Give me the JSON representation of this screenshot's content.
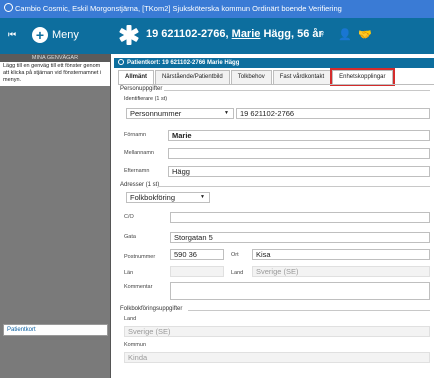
{
  "window": {
    "title": "Cambio Cosmic, Eskil Morgonstjärna, [TKom2] Sjuksköterska kommun Ordinärt boende Verifiering"
  },
  "header": {
    "menu_label": "Meny",
    "patient_pnr": "19 621102-2766,",
    "patient_firstname": "Marie",
    "patient_lastname": "Hägg,",
    "patient_age": "56 år",
    "icons": [
      "collapse-icon",
      "plus-circle-icon",
      "star-of-life-icon",
      "female-icon",
      "person-outline-icon",
      "handshake-icon"
    ]
  },
  "sidebar": {
    "title": "MINA GENVÄGAR",
    "hint": "Lägg till en genväg till ett fönster genom att klicka på stjärnan vid fönsternamnet i menyn.",
    "link": "Patientkort"
  },
  "patientcard": {
    "title": "Patientkort: 19 621102-2766 Marie Hägg",
    "tabs": [
      "Allmänt",
      "Närstående/Patientbild",
      "Tolkbehov",
      "Fast vårdkontakt",
      "Enhetskopplingar"
    ],
    "personuppgifter_label": "Personuppgifter",
    "identifierare_label": "Identifierare (1 st)",
    "id_type": "Personnummer",
    "id_value": "19 621102-2766",
    "fornamn_label": "Förnamn",
    "fornamn": "Marie",
    "mellannamn_label": "Mellannamn",
    "mellannamn": "",
    "efternamn_label": "Efternamn",
    "efternamn": "Hägg",
    "adresser_label": "Adresser (1 st)",
    "address_type": "Folkbokföring",
    "co_label": "C/O",
    "co": "",
    "gata_label": "Gata",
    "gata": "Storgatan 5",
    "postnummer_label": "Postnummer",
    "postnummer": "590 36",
    "ort_label": "Ort",
    "ort": "Kisa",
    "lan_label": "Län",
    "lan": "",
    "land_label": "Land",
    "land": "Sverige (SE)",
    "kommentar_label": "Kommentar",
    "kommentar": "",
    "folkbokforing_label": "Folkbokföringsuppgifter",
    "fb_land_label": "Land",
    "fb_land": "Sverige (SE)",
    "fb_kommun_label": "Kommun",
    "fb_kommun": "Kinda"
  },
  "colors": {
    "title_bar": "#3a7bd5",
    "header": "#0d6e9e",
    "sidebar": "#7a7a7a",
    "highlight": "#d42c2c"
  }
}
